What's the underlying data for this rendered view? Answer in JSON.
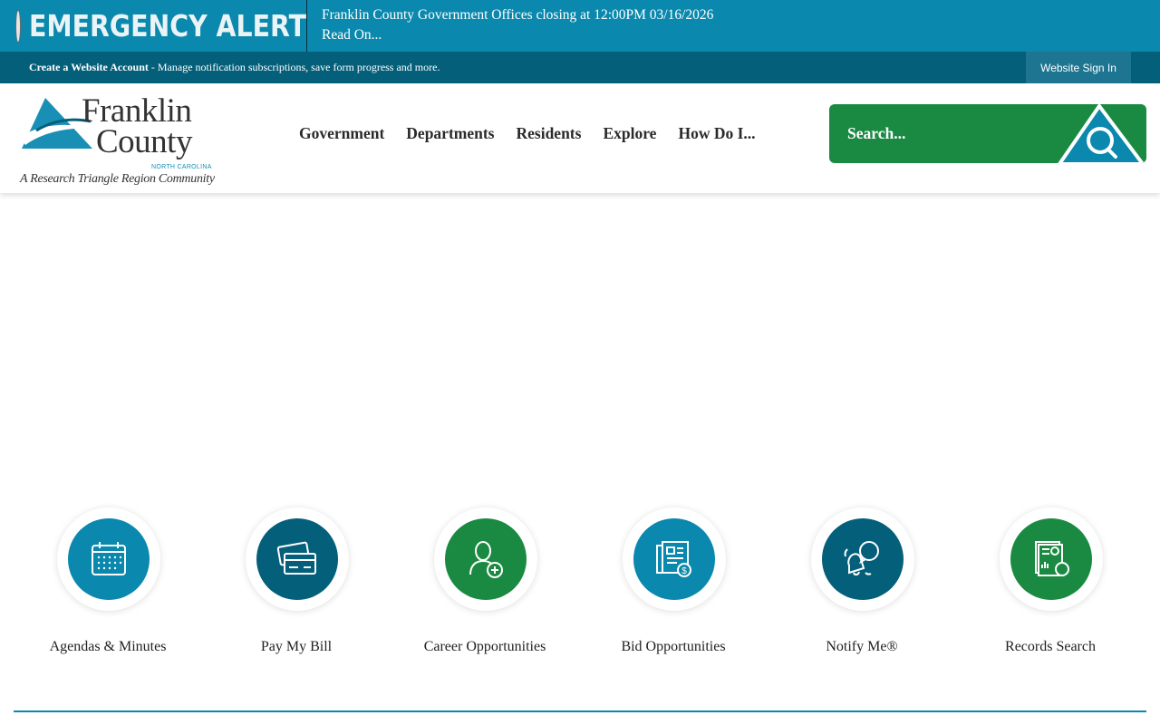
{
  "alert": {
    "title": "EMERGENCY ALERT",
    "message": "Franklin County Government Offices closing at 12:00PM 03/16/2026",
    "read_more": "Read On..."
  },
  "account_bar": {
    "create_link": "Create a Website Account",
    "description": " - Manage notification subscriptions, save form progress and more.",
    "sign_in": "Website Sign In"
  },
  "logo": {
    "line1": "Franklin",
    "line2": "County",
    "state": "NORTH CAROLINA",
    "tagline": "A Research Triangle Region Community"
  },
  "nav": {
    "items": [
      {
        "label": "Government"
      },
      {
        "label": "Departments"
      },
      {
        "label": "Residents"
      },
      {
        "label": "Explore"
      },
      {
        "label": "How Do I..."
      }
    ]
  },
  "search": {
    "placeholder": "Search..."
  },
  "quick_links": [
    {
      "label": "Agendas & Minutes",
      "icon": "calendar-icon",
      "color": "#0a88ad"
    },
    {
      "label": "Pay My Bill",
      "icon": "credit-card-icon",
      "color": "#045f7a"
    },
    {
      "label": "Career Opportunities",
      "icon": "person-add-icon",
      "color": "#1a8a42"
    },
    {
      "label": "Bid Opportunities",
      "icon": "document-dollar-icon",
      "color": "#0a88ad"
    },
    {
      "label": "Notify Me®",
      "icon": "bell-chat-icon",
      "color": "#045f7a"
    },
    {
      "label": "Records Search",
      "icon": "records-search-icon",
      "color": "#1a8a42"
    }
  ],
  "colors": {
    "alert_blue": "#0a88ad",
    "dark_teal": "#045f7a",
    "green": "#1a8a42"
  }
}
